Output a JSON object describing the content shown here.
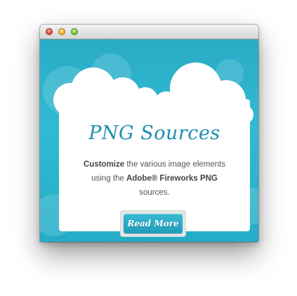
{
  "window": {
    "traffic_lights": {
      "close": "window-close-control",
      "minimize": "window-minimize-control",
      "maximize": "window-maximize-control"
    }
  },
  "card": {
    "title": "PNG Sources",
    "description": {
      "line1_bold": "Customize",
      "line1_rest": " the various image elements",
      "line2_pre": "using the ",
      "line2_bold": "Adobe® Fireworks PNG",
      "line3": "sources."
    },
    "button_label": "Read More"
  },
  "colors": {
    "background": "#27aec8",
    "title": "#1c8fb0",
    "button": "#25a8c5"
  }
}
